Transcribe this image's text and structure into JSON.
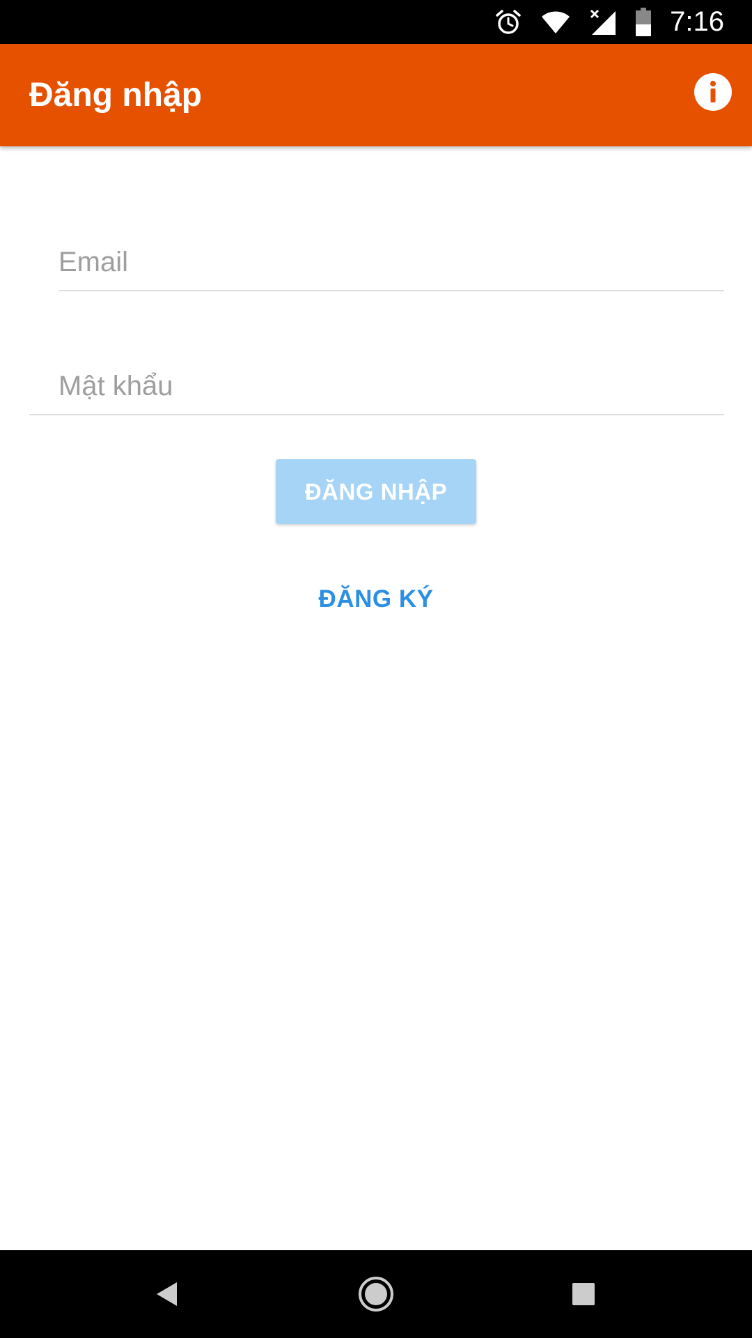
{
  "status_bar": {
    "time": "7:16",
    "icons": [
      "alarm-icon",
      "wifi-icon",
      "cellular-no-data-icon",
      "battery-icon"
    ]
  },
  "app_bar": {
    "title": "Đăng nhập",
    "background_color": "#E65100",
    "info_icon": "info-icon"
  },
  "login_form": {
    "email_placeholder": "Email",
    "email_value": "",
    "password_placeholder": "Mật khẩu",
    "password_value": "",
    "login_label": "ĐĂNG NHẬP",
    "login_button_color": "#A6D4F7",
    "register_label": "ĐĂNG KÝ",
    "register_color": "#2B8FE3"
  },
  "nav_bar": {
    "buttons": [
      "back-icon",
      "home-icon",
      "recents-icon"
    ]
  }
}
